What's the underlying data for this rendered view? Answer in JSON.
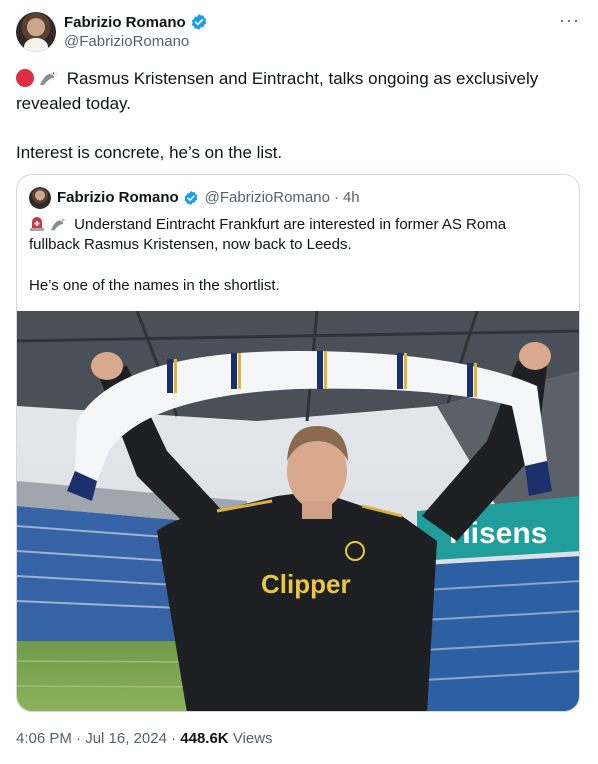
{
  "author": {
    "name": "Fabrizio Romano",
    "handle": "@FabrizioRomano"
  },
  "tweet": {
    "text_line1": "Rasmus Kristensen and Eintracht, talks ongoing as exclusively revealed today.",
    "text_line2": "Interest is concrete, he’s on the list."
  },
  "quoted": {
    "name": "Fabrizio Romano",
    "handle": "@FabrizioRomano",
    "separator": "·",
    "time": "4h",
    "text_line1": "Understand Eintracht Frankfurt are interested in former AS Roma fullback Rasmus Kristensen, now back to Leeds.",
    "text_line2": "He’s one of the names in the shortlist.",
    "photo": {
      "shirt_sponsor": "Clipper",
      "stadium_sign": "Hisens"
    }
  },
  "footer": {
    "timestamp": "4:06 PM · Jul 16, 2024 ·",
    "views_count": "448.6K",
    "views_label": "Views"
  },
  "icons": {
    "verified": "verified-badge-icon",
    "more": "more-options-icon"
  },
  "colors": {
    "verified_blue": "#1d9bf0",
    "text_secondary": "#536471"
  }
}
